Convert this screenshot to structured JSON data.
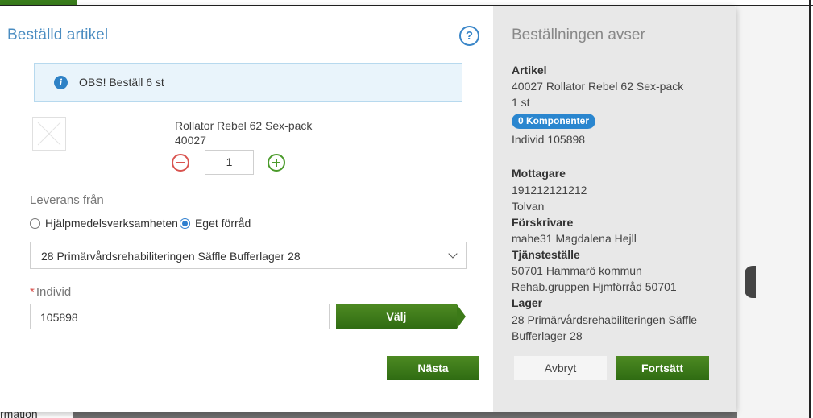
{
  "background": {
    "bottom_text": "rmation"
  },
  "modal": {
    "title": "Beställd artikel",
    "help_icon": "question-circle-icon",
    "info": {
      "icon": "info-icon",
      "text": "OBS! Beställ 6 st"
    },
    "product": {
      "name": "Rollator Rebel 62 Sex-pack",
      "number": "40027",
      "quantity": "1"
    },
    "delivery": {
      "label": "Leverans från",
      "options": [
        {
          "label": "Hjälpmedelsverksamheten",
          "selected": false
        },
        {
          "label": "Eget förråd",
          "selected": true
        }
      ],
      "selected_location": "28 Primärvårdsrehabiliteringen Säffle Bufferlager 28"
    },
    "individ": {
      "required_mark": "*",
      "label": "Individ",
      "value": "105898",
      "choose_label": "Välj"
    },
    "next_label": "Nästa"
  },
  "summary": {
    "title": "Beställningen avser",
    "article_heading": "Artikel",
    "article_line": "40027  Rollator Rebel 62 Sex-pack",
    "article_qty": "1 st",
    "components_badge": "0 Komponenter",
    "individ_line": "Individ 105898",
    "recipient_heading": "Mottagare",
    "recipient_id": "191212121212",
    "recipient_name": "Tolvan",
    "prescriber_heading": "Förskrivare",
    "prescriber": "mahe31 Magdalena Hejll",
    "unit_heading": "Tjänsteställe",
    "unit_line1": "50701 Hammarö kommun",
    "unit_line2": "Rehab.gruppen Hjmförråd 50701",
    "stock_heading": "Lager",
    "stock_line1": "28 Primärvårdsrehabiliteringen Säffle",
    "stock_line2": "Bufferlager 28",
    "cancel_label": "Avbryt",
    "continue_label": "Fortsätt"
  },
  "colors": {
    "title_blue": "#4a8cc1",
    "button_green": "#3c7a18",
    "info_bg": "#e9f4fb",
    "badge_blue": "#2a86cf",
    "summary_bg": "#e8e8e8"
  }
}
